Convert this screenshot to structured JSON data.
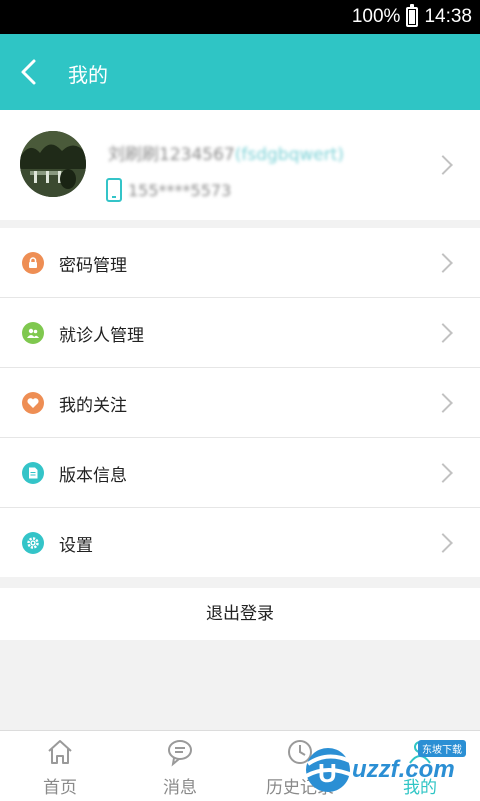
{
  "status_bar": {
    "battery": "100%",
    "time": "14:38"
  },
  "header": {
    "title": "我的"
  },
  "profile": {
    "name_primary": "刘刷刷1234567",
    "name_secondary": "(fsdgbqwert)",
    "phone": "155****5573"
  },
  "menu": [
    {
      "label": "密码管理",
      "icon": "lock-icon",
      "color": "#ee8e54"
    },
    {
      "label": "就诊人管理",
      "icon": "people-icon",
      "color": "#7fc84f"
    },
    {
      "label": "我的关注",
      "icon": "heart-icon",
      "color": "#ee8e54"
    },
    {
      "label": "版本信息",
      "icon": "document-icon",
      "color": "#34c4c8"
    },
    {
      "label": "设置",
      "icon": "gear-icon",
      "color": "#34c4c8"
    }
  ],
  "logout": {
    "label": "退出登录"
  },
  "tabs": [
    {
      "label": "首页",
      "icon": "home-icon"
    },
    {
      "label": "消息",
      "icon": "message-icon"
    },
    {
      "label": "历史记录",
      "icon": "history-icon"
    },
    {
      "label": "我的",
      "icon": "profile-icon",
      "active": true
    }
  ],
  "watermark": {
    "text": "uzzf.com",
    "sub": "东坡下载"
  },
  "colors": {
    "primary": "#2fc5c5"
  }
}
